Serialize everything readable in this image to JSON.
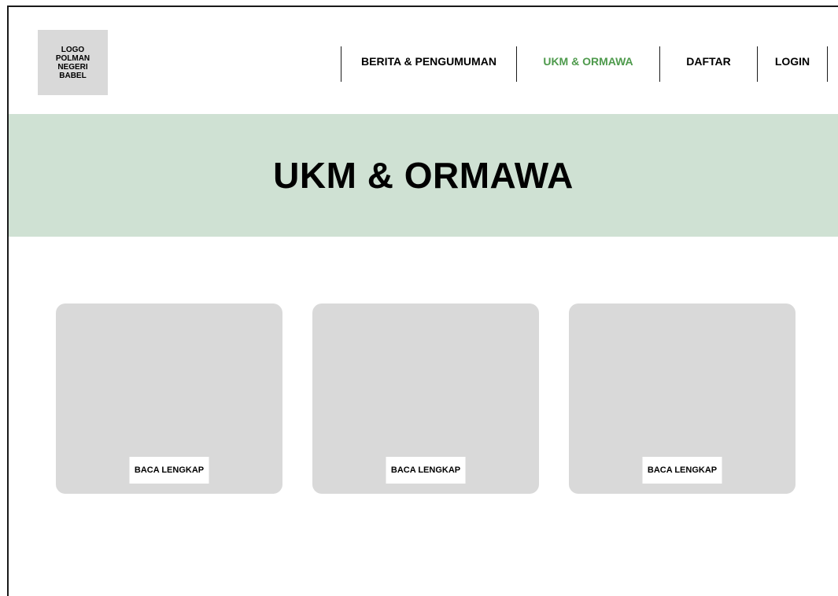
{
  "logo": {
    "text": "LOGO\nPOLMAN\nNEGERI\nBABEL"
  },
  "nav": {
    "items": [
      {
        "label": "BERITA & PENGUMUMAN",
        "active": false
      },
      {
        "label": "UKM & ORMAWA",
        "active": true
      },
      {
        "label": "DAFTAR",
        "active": false
      },
      {
        "label": "LOGIN",
        "active": false
      }
    ]
  },
  "hero": {
    "title": "UKM & ORMAWA"
  },
  "cards": [
    {
      "button_label": "BACA LENGKAP"
    },
    {
      "button_label": "BACA LENGKAP"
    },
    {
      "button_label": "BACA LENGKAP"
    }
  ],
  "colors": {
    "hero_background": "#cfe1d3",
    "active_nav": "#4e9a4c",
    "placeholder_gray": "#d9d9d9"
  }
}
